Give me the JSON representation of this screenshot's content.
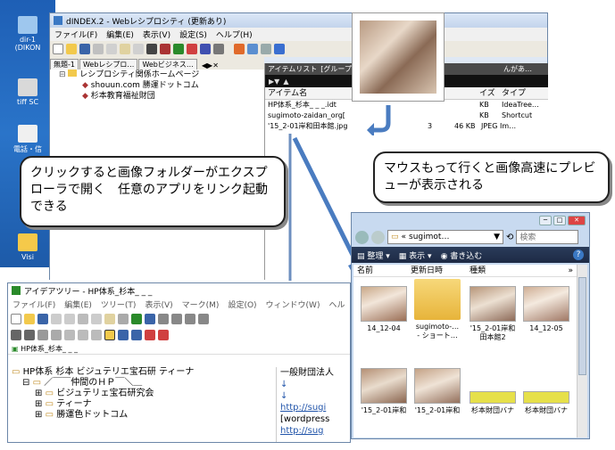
{
  "desktop": {
    "icons": [
      {
        "label": "dir-1\n(DIKON"
      },
      {
        "label": "tiff SC"
      },
      {
        "label": "電話・信"
      },
      {
        "label": "Visi"
      }
    ]
  },
  "main_window": {
    "title": "dINDEX.2 - Webレシプロシティ (更新あり)",
    "menu": [
      "ファイル(F)",
      "編集(E)",
      "表示(V)",
      "設定(S)",
      "ヘルプ(H)"
    ],
    "tabs": [
      "無題-1",
      "Webレシプロ…",
      "Webビジネス…"
    ],
    "tree": {
      "root": "レシプロシティ関係ホームページ",
      "items": [
        "shouun.com 勝運ドットコム",
        "杉本教育福祉財団"
      ]
    },
    "item_list": {
      "tab_label": "アイテムリスト",
      "tab_label2": "[グループフォ",
      "tab_label3": "んがあ…",
      "col_name": "アイテム名",
      "col_size": "イズ",
      "col_type": "タイプ",
      "rows": [
        {
          "name": "HP体系_杉本_ _ _.idt",
          "size": "KB",
          "type": "IdeaTree…"
        },
        {
          "name": "sugimoto-zaidan_org[",
          "size": "KB",
          "type": "Shortcut"
        },
        {
          "name": "'15_2-01岸和田本館.jpg",
          "num": "3",
          "size": "46 KB",
          "type": "JPEG Im…"
        }
      ]
    }
  },
  "callout_left": {
    "text": "クリックすると画像フォルダーがエクスプローラで開く　任意のアプリをリンク起動できる"
  },
  "callout_right": {
    "text": "マウスもって行くと画像高速にプレビューが表示される"
  },
  "idea_window": {
    "title": "アイデアツリー - HP体系_杉本_ _ _",
    "menu": [
      "ファイル(F)",
      "編集(E)",
      "ツリー(T)",
      "表示(V)",
      "マーク(M)",
      "設定(O)",
      "ウィンドウ(W)",
      "ヘル"
    ],
    "doc_tab": "HP体系_杉本_ _ _",
    "tree": [
      "HP体系  杉本  ビジュテリエ宝石研  ティーナ",
      "／￣￣仲間のＨＰ￣＼＿",
      "ビジュテリェ宝石研究会",
      "ティーナ",
      "勝運色ドットコム"
    ],
    "right_text": [
      "一般財団法人",
      "↓",
      "↓",
      "http://sugi",
      "[wordpress",
      "http://sug"
    ]
  },
  "explorer": {
    "path": "sugimot…",
    "search_placeholder": "検索",
    "toolbar": [
      "整理",
      "表示",
      "書き込む"
    ],
    "columns": [
      "名前",
      "更新日時",
      "種類"
    ],
    "items": [
      {
        "label": "14_12-04"
      },
      {
        "label": "sugimoto-…\n- ショート…"
      },
      {
        "label": "'15_2-01岸和\n田本館2"
      },
      {
        "label": "14_12-05"
      },
      {
        "label": "'15_2-01岸和"
      },
      {
        "label": "'15_2-01岸和"
      },
      {
        "label": "杉本財団バナ"
      },
      {
        "label": "杉本財団バナ"
      }
    ]
  },
  "colors": {
    "accent_blue": "#1e5fb5",
    "arrow_blue": "#4a7cc0",
    "tree_green": "#1a7a1a"
  }
}
